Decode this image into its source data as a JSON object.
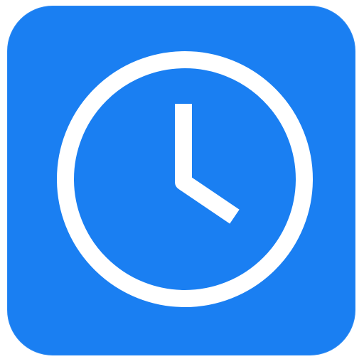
{
  "app_icon": {
    "icon": "clock-icon",
    "tile_color": "#1a7ff2",
    "glyph_color": "#ffffff"
  }
}
